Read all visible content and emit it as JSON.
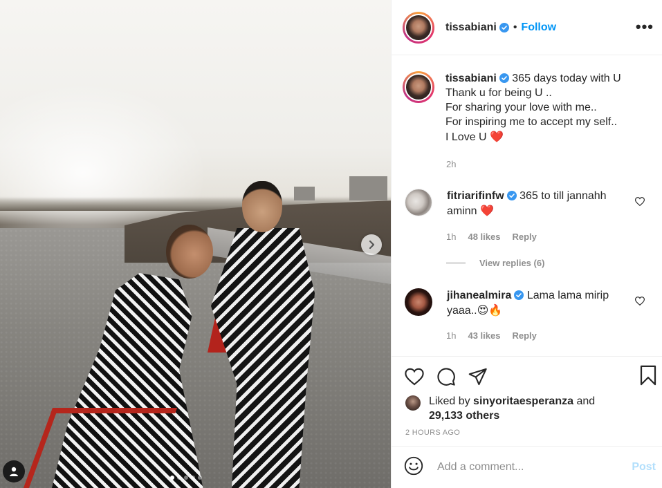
{
  "post": {
    "author": "tissabiani",
    "follow_separator": "•",
    "follow_label": "Follow",
    "more_label": "•••",
    "caption_lines": [
      "365 days today with U",
      "Thank u for being U ..",
      "For sharing your love with me..",
      "For inspiring me to accept my self..",
      "I Love U"
    ],
    "caption_emoji": "❤️",
    "caption_time": "2h"
  },
  "carousel": {
    "total_slides": 5,
    "active_slide": 1
  },
  "comments": [
    {
      "username": "fitriarifinfw",
      "verified": true,
      "text": "365 to till jannahh aminn",
      "emoji": "❤️",
      "time": "1h",
      "likes": "48 likes",
      "reply_label": "Reply",
      "view_replies": "View replies (6)"
    },
    {
      "username": "jihanealmira",
      "verified": true,
      "text": "Lama lama mirip yaaa..",
      "emoji": "😍🔥",
      "time": "1h",
      "likes": "43 likes",
      "reply_label": "Reply"
    }
  ],
  "likes": {
    "prefix": "Liked by",
    "user": "sinyoritaesperanza",
    "and": "and",
    "others": "29,133 others"
  },
  "timestamp": "2 HOURS AGO",
  "add_comment": {
    "placeholder": "Add a comment...",
    "post_label": "Post"
  },
  "colors": {
    "accent": "#0095f6",
    "verified": "#3897f0",
    "heart_red": "#ed4956",
    "muted": "#8e8e8e",
    "post_disabled": "#b2dffc"
  },
  "icons": [
    "tag-user-icon",
    "chevron-right-icon",
    "verified-icon",
    "more-icon",
    "heart-icon",
    "comment-icon",
    "share-icon",
    "bookmark-icon",
    "emoji-icon"
  ]
}
